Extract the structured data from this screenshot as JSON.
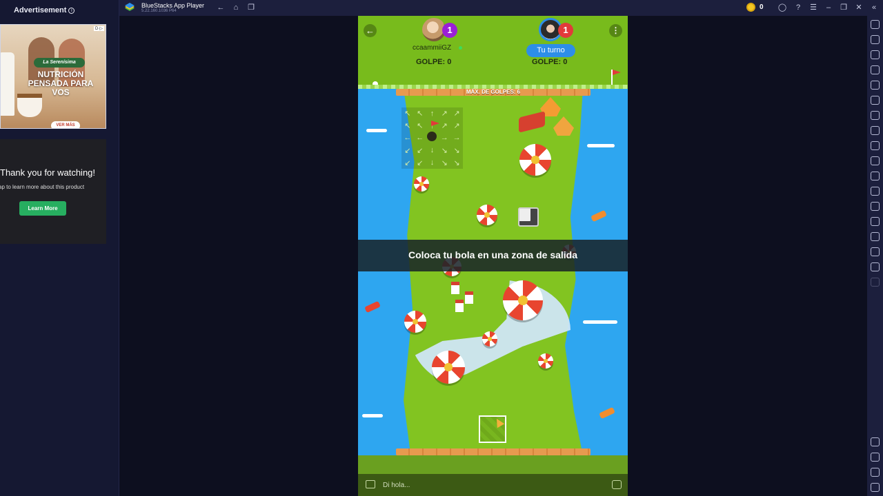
{
  "ad": {
    "label": "Advertisement",
    "brand": "La Serenísima",
    "headline": "NUTRICIÓN PENSADA PARA VOS",
    "cta": "VER MÁS",
    "corner": "D·▷",
    "video_thanks": "Thank you for watching!",
    "video_tap": "Tap to learn more about this product",
    "learn_more": "Learn More"
  },
  "titlebar": {
    "app_name": "BlueStacks App Player",
    "version": "5.22.160.1036 P64",
    "coin_count": "0",
    "icons": [
      "back-icon",
      "home-icon",
      "recent-apps-icon",
      "account-icon",
      "help-icon",
      "menu-icon",
      "minimize-icon",
      "restore-icon",
      "close-icon",
      "collapse-icon"
    ]
  },
  "right_toolbar": {
    "icons": [
      "fullscreen-icon",
      "volume-icon",
      "media-icon",
      "keyboard-icon",
      "macro-icon",
      "rotate-icon",
      "game-controls-icon",
      "performance-icon",
      "screenshot-icon",
      "screen-record-icon",
      "media-manager-icon",
      "airplane-icon",
      "multi-instance-icon",
      "eco-mode-icon",
      "location-icon",
      "layers-icon",
      "sync-icon",
      "disabled-icon",
      "settings-icon",
      "back-icon",
      "home-icon",
      "recent-icon"
    ]
  },
  "game": {
    "player1": {
      "name": "ccaammiiGZ",
      "badge": "1",
      "strokes": "GOLPE: 0"
    },
    "player2": {
      "turn_label": "Tu turno",
      "badge": "1",
      "strokes": "GOLPE: 0"
    },
    "max_strokes": "MÁX. DE GOLPES: 6",
    "banner": "Coloca tu bola en una zona de salida",
    "chat_placeholder": "Di hola...",
    "arrows": [
      "↖",
      "↖",
      "↑",
      "↗",
      "↗",
      "↖",
      "↖",
      "↑",
      "↗",
      "↗",
      "←",
      "←",
      "",
      "→",
      "→",
      "↙",
      "↙",
      "↓",
      "↘",
      "↘",
      "↙",
      "↙",
      "↓",
      "↘",
      "↘"
    ]
  },
  "colors": {
    "grass": "#7dc01f",
    "water": "#2ea6f0",
    "turn_blue": "#2d8ee8",
    "badge_purple": "#9b1fd6",
    "badge_red": "#e23a3a",
    "learn_green": "#27ae60"
  }
}
